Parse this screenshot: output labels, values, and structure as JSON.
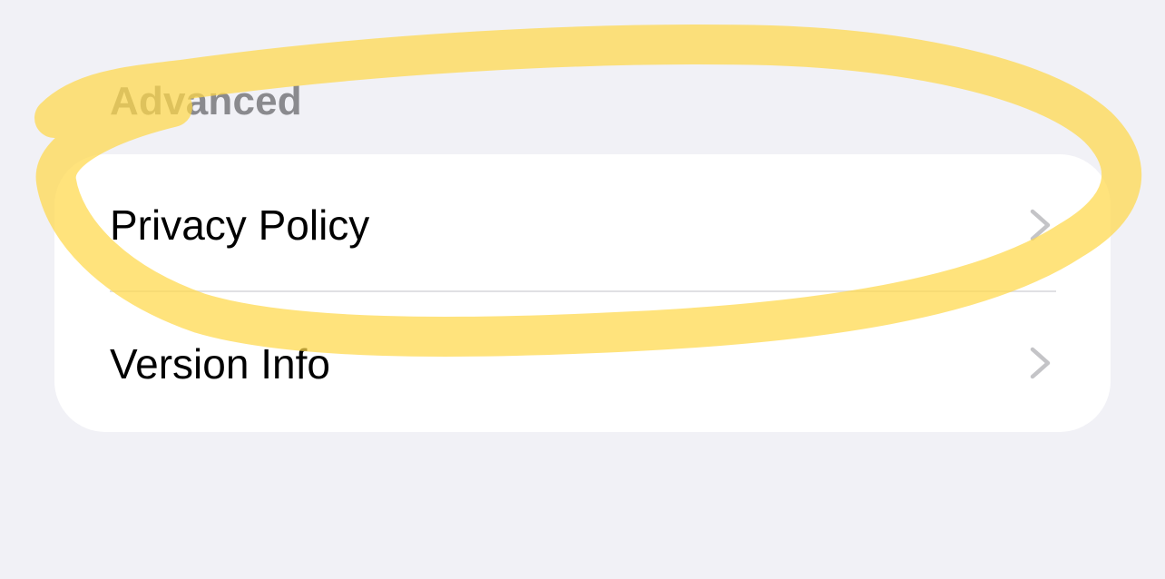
{
  "section": {
    "title": "Advanced"
  },
  "rows": [
    {
      "label": "Privacy Policy"
    },
    {
      "label": "Version Info"
    }
  ],
  "icons": {
    "chevron": "chevron-right-icon"
  },
  "colors": {
    "background": "#f1f1f6",
    "card": "#ffffff",
    "header_text": "#8a8a8e",
    "chevron": "#c4c4c7",
    "highlight": "#ffd84a"
  }
}
